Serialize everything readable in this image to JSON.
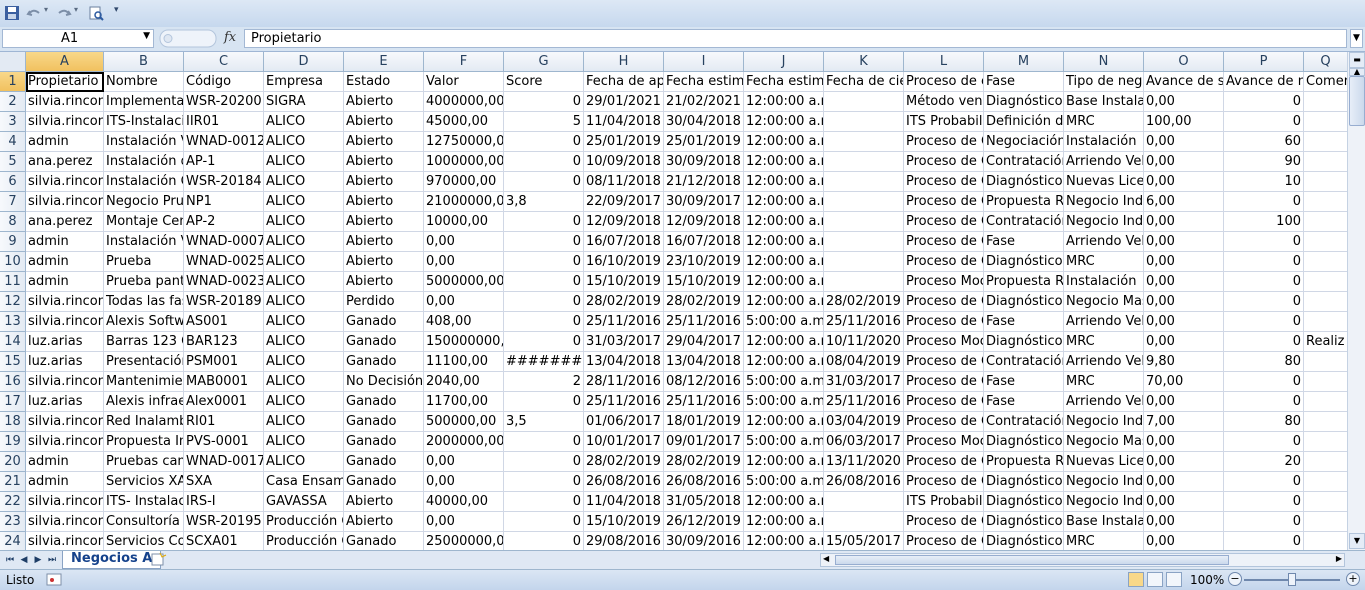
{
  "name_box": "A1",
  "fx_symbol": "fx",
  "formula_value": "Propietario",
  "columns": [
    "A",
    "B",
    "C",
    "D",
    "E",
    "F",
    "G",
    "H",
    "I",
    "J",
    "K",
    "L",
    "M",
    "N",
    "O",
    "P",
    "Q"
  ],
  "rows": [
    [
      "Propietario",
      "Nombre",
      "Código",
      "Empresa",
      "Estado",
      "Valor",
      "Score",
      "Fecha de ape",
      "Fecha estima",
      "Fecha estima",
      "Fecha de cie",
      "Proceso de c",
      "Fase",
      "Tipo de nego",
      "Avance de so",
      "Avance de n",
      "Comen"
    ],
    [
      "silvia.rincon",
      "Implementa",
      "WSR-20200",
      "SIGRA",
      "Abierto",
      "4000000,00",
      "0",
      "29/01/2021 1",
      "21/02/2021",
      "12:00:00 a.m.",
      "",
      "Método ven",
      "Diagnóstico",
      "Base Instala",
      "0,00",
      "0",
      ""
    ],
    [
      "silvia.rincon",
      "ITS-Instalacio",
      "IIR01",
      "ALICO",
      "Abierto",
      "45000,00",
      "5",
      "11/04/2018 1",
      "30/04/2018",
      "12:00:00 a.m.",
      "",
      "ITS Probabili",
      "Definición d",
      "MRC",
      "100,00",
      "0",
      ""
    ],
    [
      "admin",
      "Instalación V",
      "WNAD-0012",
      "ALICO",
      "Abierto",
      "12750000,00",
      "0",
      "25/01/2019 1",
      "25/01/2019",
      "12:00:00 a.m.",
      "",
      "Proceso de C",
      "Negociación",
      "Instalación",
      "0,00",
      "60",
      ""
    ],
    [
      "ana.perez",
      "Instalación d",
      "AP-1",
      "ALICO",
      "Abierto",
      "1000000,00",
      "0",
      "10/09/2018 1",
      "30/09/2018",
      "12:00:00 a.m.",
      "",
      "Proceso de C",
      "Contratación",
      "Arriendo Vel",
      "0,00",
      "90",
      ""
    ],
    [
      "silvia.rincon",
      "Instalación C",
      "WSR-20184",
      "ALICO",
      "Abierto",
      "970000,00",
      "0",
      "08/11/2018 1",
      "21/12/2018",
      "12:00:00 a.m.",
      "",
      "Proceso de C",
      "Diagnóstico",
      "Nuevas Licer",
      "0,00",
      "10",
      ""
    ],
    [
      "silvia.rincon",
      "Negocio Pru",
      "NP1",
      "ALICO",
      "Abierto",
      "21000000,00",
      "3,8",
      "22/09/2017 1",
      "30/09/2017",
      "12:00:00 a.m.",
      "",
      "Proceso de C",
      "Propuesta Re",
      "Negocio Indu",
      "6,00",
      "0",
      ""
    ],
    [
      "ana.perez",
      "Montaje Cen",
      "AP-2",
      "ALICO",
      "Abierto",
      "10000,00",
      "0",
      "12/09/2018 1",
      "12/09/2018",
      "12:00:00 a.m.",
      "",
      "Proceso de C",
      "Contratación",
      "Negocio Indu",
      "0,00",
      "100",
      ""
    ],
    [
      "admin",
      "Instalación V",
      "WNAD-0007",
      "ALICO",
      "Abierto",
      "0,00",
      "0",
      "16/07/2018 1",
      "16/07/2018",
      "12:00:00 a.m.",
      "",
      "Proceso de C",
      "Fase",
      "Arriendo Vel",
      "0,00",
      "0",
      ""
    ],
    [
      "admin",
      "Prueba",
      "WNAD-0025",
      "ALICO",
      "Abierto",
      "0,00",
      "0",
      "16/10/2019 1",
      "23/10/2019",
      "12:00:00 a.m.",
      "",
      "Proceso de C",
      "Diagnóstico",
      "MRC",
      "0,00",
      "0",
      ""
    ],
    [
      "admin",
      "Prueba pant",
      "WNAD-0023",
      "ALICO",
      "Abierto",
      "5000000,00",
      "0",
      "15/10/2019 1",
      "15/10/2019",
      "12:00:00 a.m.",
      "",
      "Proceso Moc",
      "Propuesta Re",
      "Instalación",
      "0,00",
      "0",
      ""
    ],
    [
      "silvia.rincon",
      "Todas las fas",
      "WSR-20189",
      "ALICO",
      "Perdido",
      "0,00",
      "0",
      "28/02/2019 1",
      "28/02/2019",
      "12:00:00 a.m.",
      "28/02/2019 1",
      "Proceso de C",
      "Diagnóstico",
      "Negocio Mas",
      "0,00",
      "0",
      ""
    ],
    [
      "silvia.rincon",
      "Alexis Softw",
      "AS001",
      "ALICO",
      "Ganado",
      "408,00",
      "0",
      "25/11/2016 5",
      "25/11/2016",
      "5:00:00 a.m.",
      "25/11/2016 5",
      "Proceso de C",
      "Fase",
      "Arriendo Vel",
      "0,00",
      "0",
      ""
    ],
    [
      "luz.arias",
      "Barras 123 O",
      "BAR123",
      "ALICO",
      "Ganado",
      "150000000,00",
      "0",
      "31/03/2017 1",
      "29/04/2017",
      "12:00:00 a.m.",
      "10/11/2020 1",
      "Proceso Moc",
      "Diagnóstico",
      "MRC",
      "0,00",
      "0",
      "Realiz"
    ],
    [
      "luz.arias",
      "Presentación",
      "PSM001",
      "ALICO",
      "Ganado",
      "11100,00",
      "##########",
      "13/04/2018 1",
      "13/04/2018",
      "12:00:00 a.m.",
      "08/04/2019 1",
      "Proceso de C",
      "Contratación",
      "Arriendo Vel",
      "9,80",
      "80",
      ""
    ],
    [
      "silvia.rincon",
      "Mantenimie",
      "MAB0001",
      "ALICO",
      "No Decisión",
      "2040,00",
      "2",
      "28/11/2016 5",
      "08/12/2016",
      "5:00:00 a.m.",
      "31/03/2017 5",
      "Proceso de C",
      "Fase",
      "MRC",
      "70,00",
      "0",
      ""
    ],
    [
      "luz.arias",
      "Alexis infrae",
      "Alex0001",
      "ALICO",
      "Ganado",
      "11700,00",
      "0",
      "25/11/2016 5",
      "25/11/2016",
      "5:00:00 a.m.",
      "25/11/2016 5",
      "Proceso de C",
      "Fase",
      "Arriendo Vel",
      "0,00",
      "0",
      ""
    ],
    [
      "silvia.rincon",
      "Red Inalamb",
      "RI01",
      "ALICO",
      "Ganado",
      "500000,00",
      "3,5",
      "01/06/2017 1",
      "18/01/2019",
      "12:00:00 a.m.",
      "03/04/2019 1",
      "Proceso de C",
      "Contratación",
      "Negocio Indu",
      "7,00",
      "80",
      ""
    ],
    [
      "silvia.rincon",
      "Propuesta In",
      "PVS-0001",
      "ALICO",
      "Ganado",
      "2000000,00",
      "0",
      "10/01/2017 5",
      "09/01/2017",
      "5:00:00 a.m.",
      "06/03/2017 5",
      "Proceso Moc",
      "Diagnóstico",
      "Negocio Mas",
      "0,00",
      "0",
      ""
    ],
    [
      "admin",
      "Pruebas cam",
      "WNAD-0017",
      "ALICO",
      "Ganado",
      "0,00",
      "0",
      "28/02/2019 1",
      "28/02/2019",
      "12:00:00 a.m.",
      "13/11/2020 1",
      "Proceso de C",
      "Propuesta Re",
      "Nuevas Licer",
      "0,00",
      "20",
      ""
    ],
    [
      "admin",
      "Servicios XA",
      "SXA",
      "Casa Ensamb",
      "Ganado",
      "0,00",
      "0",
      "26/08/2016 5",
      "26/08/2016",
      "5:00:00 a.m.",
      "26/08/2016 5",
      "Proceso de C",
      "Diagnóstico",
      "Negocio Indu",
      "0,00",
      "0",
      ""
    ],
    [
      "silvia.rincon",
      "ITS- Instalaci",
      "IRS-I",
      "GAVASSA",
      "Abierto",
      "40000,00",
      "0",
      "11/04/2018 1",
      "31/05/2018",
      "12:00:00 a.m.",
      "",
      "ITS Probabili",
      "Diagnóstico",
      "Negocio Indu",
      "0,00",
      "0",
      ""
    ],
    [
      "silvia.rincon",
      "Consultoría",
      "WSR-20195",
      "Producción C",
      "Abierto",
      "0,00",
      "0",
      "15/10/2019 1",
      "26/12/2019",
      "12:00:00 a.m.",
      "",
      "Proceso de C",
      "Diagnóstico",
      "Base Instala",
      "0,00",
      "0",
      ""
    ],
    [
      "silvia.rincon",
      "Servicios Co",
      "SCXA01",
      "Producción C",
      "Ganado",
      "25000000,00",
      "0",
      "29/08/2016 5",
      "30/09/2016",
      "12:00:00 a.m.",
      "15/05/2017 5",
      "Proceso de C",
      "Diagnóstico",
      "MRC",
      "0,00",
      "0",
      ""
    ]
  ],
  "sheet_tab": "Negocios A",
  "status_text": "Listo",
  "zoom_level": "100%",
  "zoom_minus": "−",
  "zoom_plus": "+",
  "colors": {
    "accent": "#15428b",
    "selection": "#f1c15f",
    "grid": "#d0d7e5"
  }
}
